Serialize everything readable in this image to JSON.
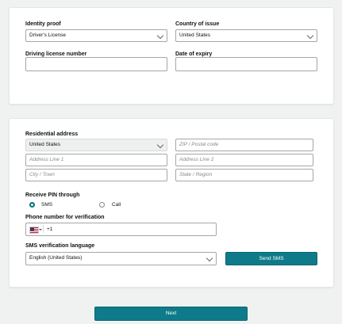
{
  "identity": {
    "proof_label": "Identity proof",
    "proof_value": "Driver's License",
    "country_label": "Country of issue",
    "country_value": "United States",
    "license_label": "Driving license number",
    "license_value": "",
    "expiry_label": "Date of expiry",
    "expiry_value": ""
  },
  "address": {
    "label": "Residential address",
    "country_value": "United States",
    "zip_placeholder": "ZIP / Postal code",
    "line1_placeholder": "Address Line 1",
    "line2_placeholder": "Address Line 2",
    "city_placeholder": "City / Town",
    "state_placeholder": "State / Region"
  },
  "pin": {
    "label": "Receive PIN through",
    "options": [
      {
        "label": "SMS",
        "selected": true
      },
      {
        "label": "Call",
        "selected": false
      }
    ]
  },
  "phone": {
    "label": "Phone number for verification",
    "country_code": "+1",
    "flag_icon": "us-flag-icon"
  },
  "sms_language": {
    "label": "SMS verification language",
    "value": "English (United States)",
    "send_button": "Send SMS"
  },
  "footer": {
    "next_button": "Next"
  },
  "colors": {
    "accent": "#0f7b8a",
    "background": "#f0f2f2",
    "card": "#ffffff"
  }
}
